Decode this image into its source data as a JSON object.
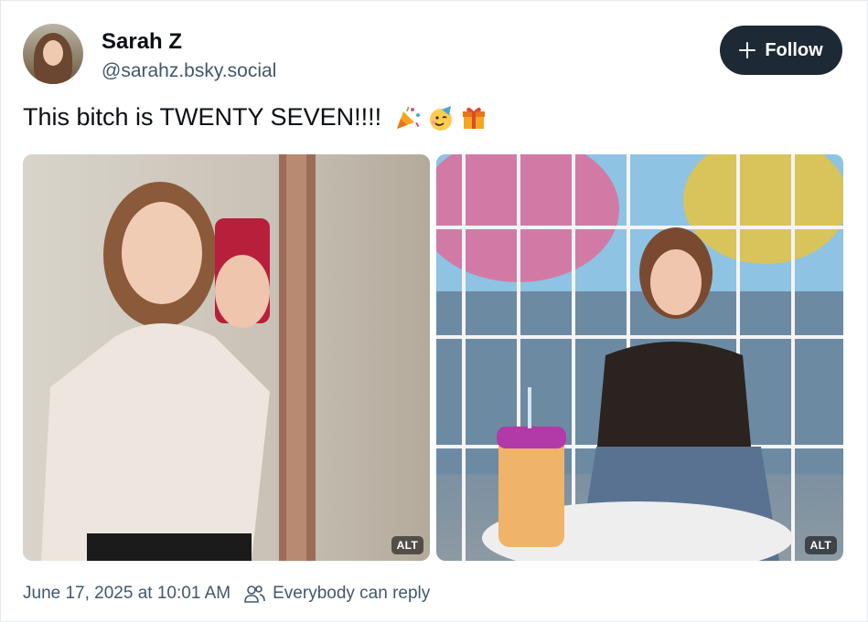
{
  "author": {
    "name": "Sarah Z",
    "handle": "@sarahz.bsky.social"
  },
  "follow_button": {
    "label": "Follow",
    "icon": "plus-icon"
  },
  "post": {
    "text": "This bitch is TWENTY SEVEN!!!!",
    "emojis": [
      "party-popper-emoji",
      "partying-face-emoji",
      "wrapped-gift-emoji"
    ]
  },
  "images": [
    {
      "alt_badge": "ALT"
    },
    {
      "alt_badge": "ALT"
    }
  ],
  "footer": {
    "timestamp": "June 17, 2025 at 10:01 AM",
    "reply_setting": "Everybody can reply",
    "reply_icon": "people-icon"
  },
  "colors": {
    "follow_button_bg": "#1e2936",
    "secondary_text": "#42576c",
    "primary_text": "#0b0f14"
  }
}
